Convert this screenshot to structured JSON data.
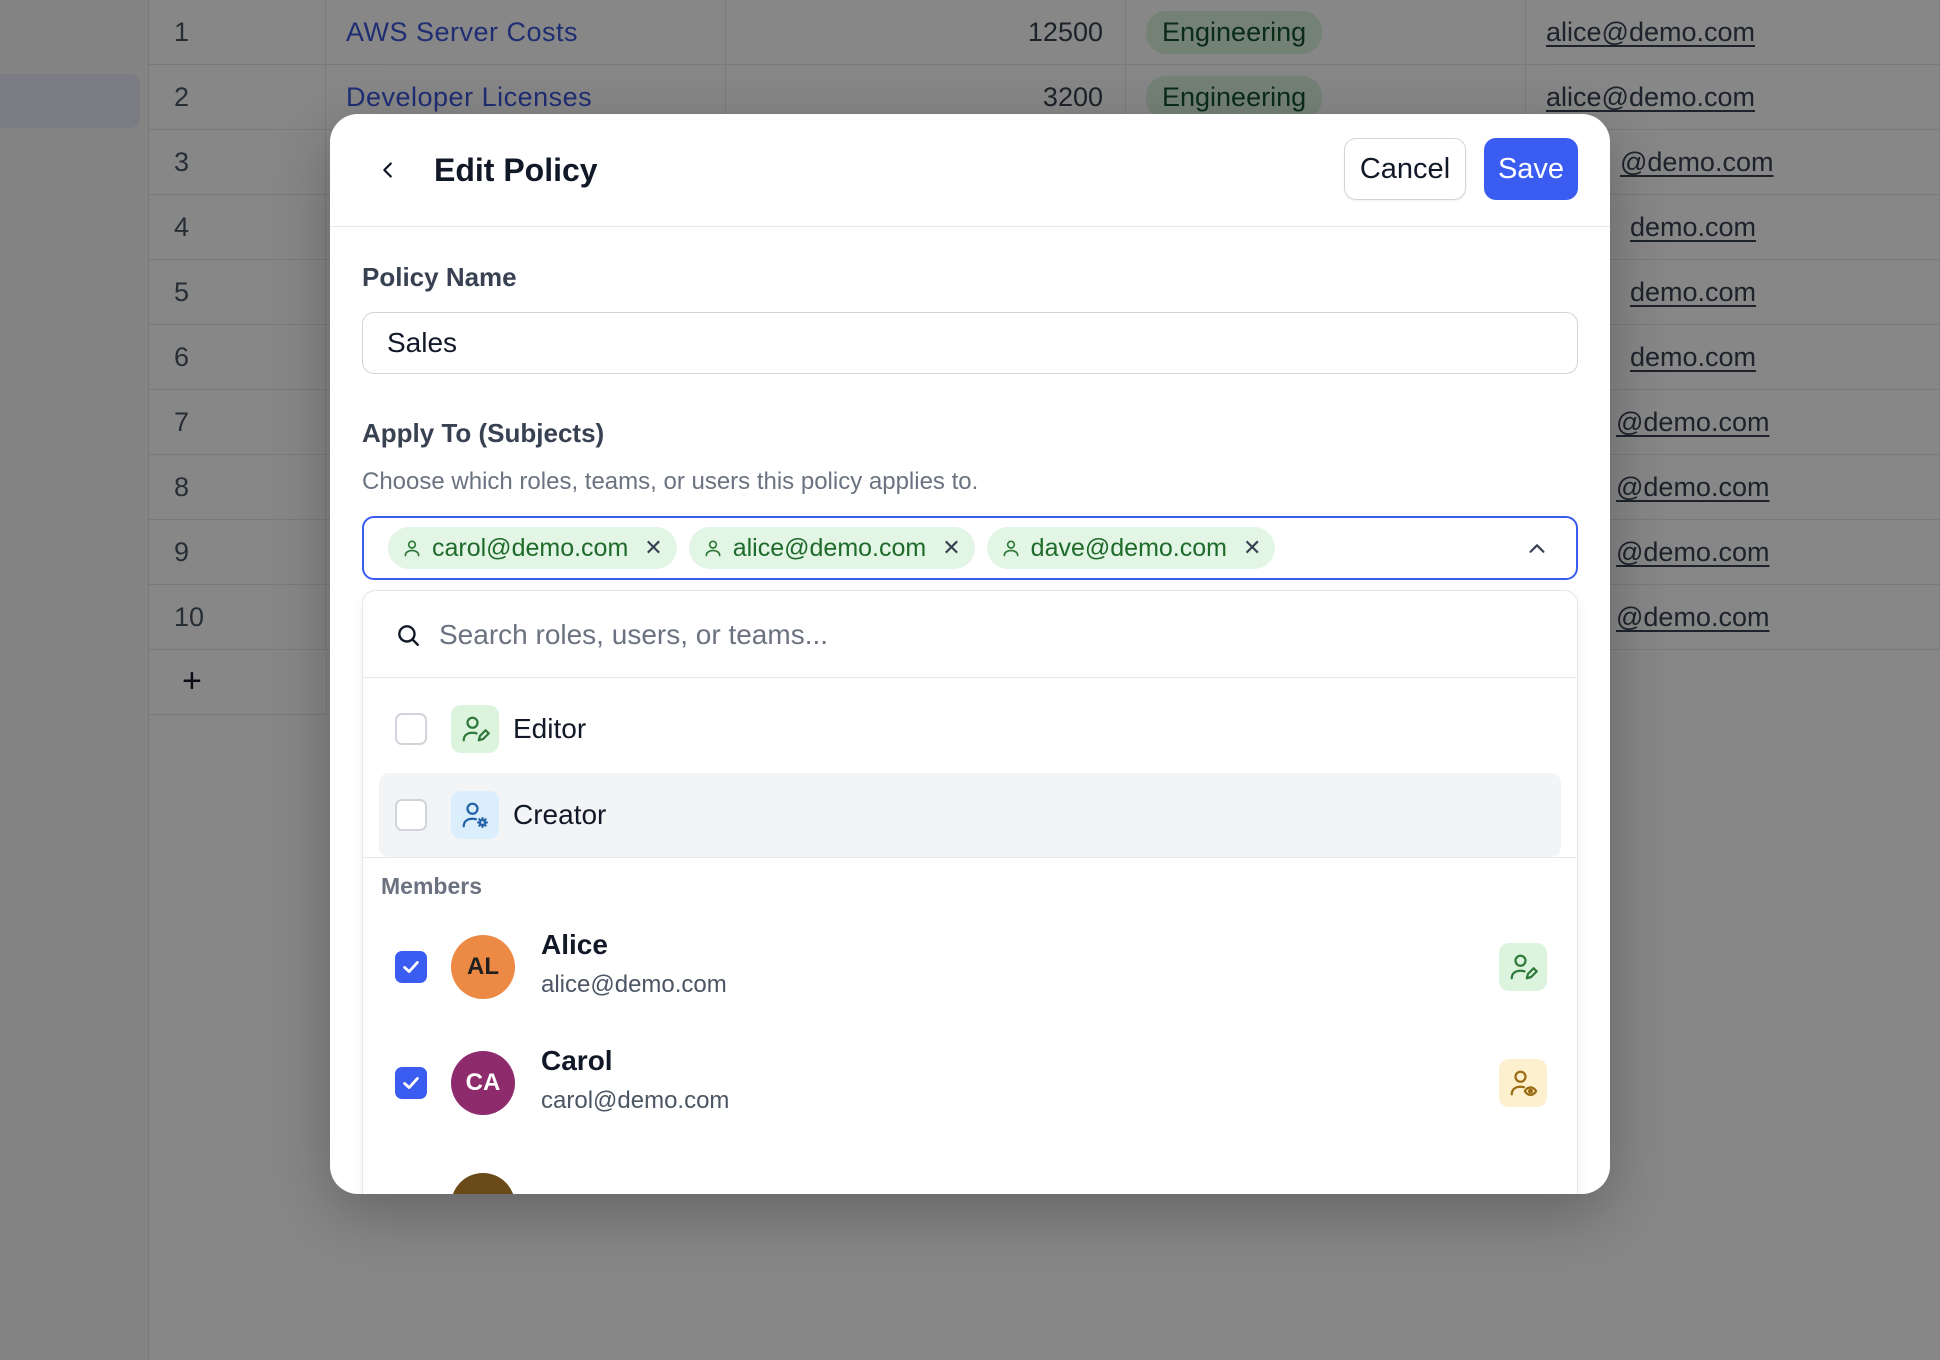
{
  "background_table": {
    "rows": [
      {
        "num": "1",
        "description": "AWS Server Costs",
        "amount": "12500",
        "department": "Engineering",
        "email": "alice@demo.com"
      },
      {
        "num": "2",
        "description": "Developer Licenses",
        "amount": "3200",
        "department": "Engineering",
        "email": "alice@demo.com"
      },
      {
        "num": "3",
        "email_visible": "@demo.com"
      },
      {
        "num": "4",
        "email_visible": "demo.com"
      },
      {
        "num": "5",
        "email_visible": "demo.com"
      },
      {
        "num": "6",
        "email_visible": "demo.com"
      },
      {
        "num": "7",
        "email_visible": "@demo.com"
      },
      {
        "num": "8",
        "email_visible": "@demo.com"
      },
      {
        "num": "9",
        "email_visible": "@demo.com"
      },
      {
        "num": "10",
        "email_visible": "@demo.com"
      }
    ],
    "add_row_label": "+"
  },
  "modal": {
    "title": "Edit Policy",
    "cancel_label": "Cancel",
    "save_label": "Save",
    "policy_name_label": "Policy Name",
    "policy_name_value": "Sales",
    "apply_to_label": "Apply To (Subjects)",
    "apply_to_helper": "Choose which roles, teams, or users this policy applies to.",
    "selected_subjects": [
      {
        "label": "carol@demo.com",
        "icon": "user-icon"
      },
      {
        "label": "alice@demo.com",
        "icon": "user-icon"
      },
      {
        "label": "dave@demo.com",
        "icon": "user-icon"
      }
    ],
    "dropdown": {
      "search_placeholder": "Search roles, users, or teams...",
      "roles": [
        {
          "label": "Editor",
          "checked": false,
          "icon": "user-edit-icon",
          "color": "#dcf3de"
        },
        {
          "label": "Creator",
          "checked": false,
          "icon": "user-gear-icon",
          "color": "#dbeefc"
        }
      ],
      "members_section_label": "Members",
      "members": [
        {
          "initials": "AL",
          "name": "Alice",
          "email": "alice@demo.com",
          "checked": true,
          "avatar_color": "#ec8a45",
          "role_icon": "user-edit-icon"
        },
        {
          "initials": "CA",
          "name": "Carol",
          "email": "carol@demo.com",
          "checked": true,
          "avatar_color": "#8e2b6d",
          "role_icon": "user-eye-icon"
        }
      ]
    }
  },
  "colors": {
    "primary": "#3b5cf0",
    "chip_bg": "#e3f5e5",
    "chip_text": "#1e6b2b",
    "overlay": "rgba(0,0,0,0.47)"
  }
}
